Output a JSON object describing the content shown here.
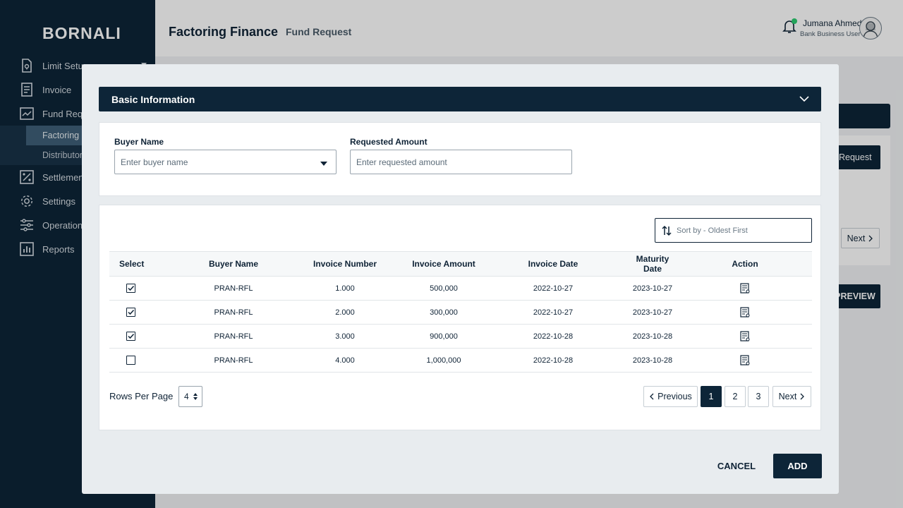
{
  "sidebar": {
    "logo": "BORNALI",
    "items": [
      {
        "label": "Limit Setup",
        "icon": "document-lock-icon"
      },
      {
        "label": "Invoice",
        "icon": "receipt-icon"
      },
      {
        "label": "Fund Requ",
        "icon": "chart-trend-icon"
      },
      {
        "label": "Settlemen",
        "icon": "percent-icon"
      },
      {
        "label": "Settings",
        "icon": "gear-icon"
      },
      {
        "label": "Operation",
        "icon": "sliders-icon"
      },
      {
        "label": "Reports",
        "icon": "bar-chart-icon"
      }
    ],
    "sub_items": [
      {
        "label": "Factoring F",
        "active": true
      },
      {
        "label": "Distributor",
        "active": false
      }
    ]
  },
  "header": {
    "title": "Factoring Finance",
    "subtitle": "Fund Request",
    "user_name": "Jumana Ahmed",
    "user_role": "Bank Business User"
  },
  "background": {
    "request_button": "Request",
    "next_button": "Next",
    "preview_button": "PREVIEW"
  },
  "modal": {
    "section_title": "Basic Information",
    "buyer_name_label": "Buyer Name",
    "buyer_name_placeholder": "Enter buyer name",
    "requested_amount_label": "Requested Amount",
    "requested_amount_placeholder": "Enter requested amount",
    "sort_placeholder": "Sort by - Oldest First",
    "table": {
      "columns": [
        "Select",
        "Buyer Name",
        "Invoice Number",
        "Invoice Amount",
        "Invoice Date",
        "Maturity Date",
        "Action"
      ],
      "rows": [
        {
          "checked": true,
          "buyer": "PRAN-RFL",
          "invoice_no": "1.000",
          "amount": "500,000",
          "invoice_date": "2022-10-27",
          "maturity_date": "2023-10-27"
        },
        {
          "checked": true,
          "buyer": "PRAN-RFL",
          "invoice_no": "2.000",
          "amount": "300,000",
          "invoice_date": "2022-10-27",
          "maturity_date": "2023-10-27"
        },
        {
          "checked": true,
          "buyer": "PRAN-RFL",
          "invoice_no": "3.000",
          "amount": "900,000",
          "invoice_date": "2022-10-28",
          "maturity_date": "2023-10-28"
        },
        {
          "checked": false,
          "buyer": "PRAN-RFL",
          "invoice_no": "4.000",
          "amount": "1,000,000",
          "invoice_date": "2022-10-28",
          "maturity_date": "2023-10-28"
        }
      ]
    },
    "rows_per_page_label": "Rows Per Page",
    "rows_per_page_value": "4",
    "pagination": {
      "previous": "Previous",
      "pages": [
        "1",
        "2",
        "3"
      ],
      "current": "1",
      "next": "Next"
    },
    "cancel_label": "CANCEL",
    "add_label": "ADD"
  },
  "colors": {
    "primary": "#0d2538",
    "modal_bg": "#e8ecef",
    "active_sub_item": "#3f6078",
    "notification": "#2ecc71"
  }
}
